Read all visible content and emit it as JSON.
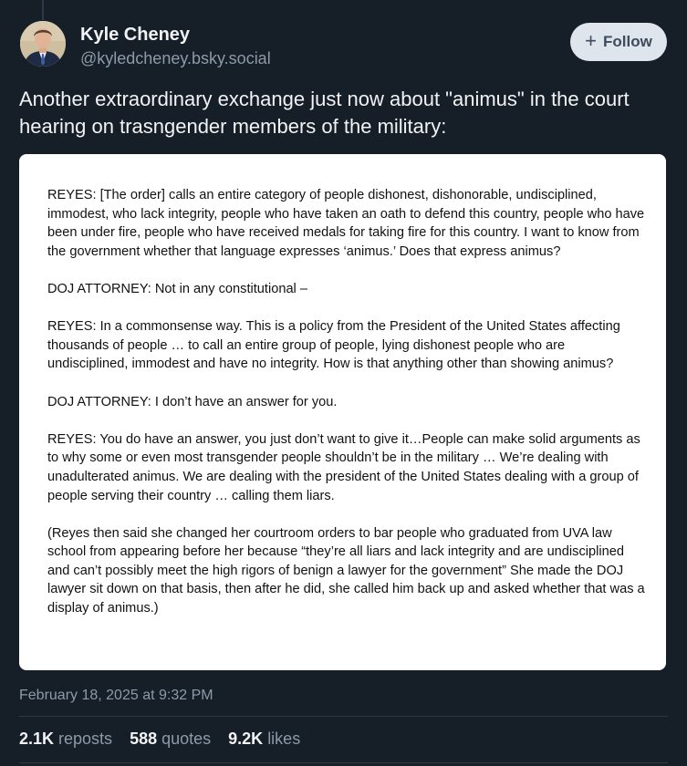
{
  "author": {
    "name": "Kyle Cheney",
    "handle": "@kyledcheney.bsky.social"
  },
  "follow_button": {
    "label": "Follow",
    "icon": "plus-icon"
  },
  "post": {
    "text": "Another extraordinary exchange just now about \"animus\" in the court hearing on trasngender members of the military:",
    "image_paragraphs": [
      "REYES: [The order] calls an entire category of people dishonest, dishonorable, undisciplined, immodest, who lack integrity, people who have taken an oath to defend this country, people who have been under fire, people who have received medals for taking fire for this country. I want to know from the government whether that language expresses ‘animus.’ Does that express animus?",
      "DOJ ATTORNEY: Not in any constitutional –",
      "REYES: In a commonsense way. This is a policy from the President of the United States affecting thousands of people … to call an entire group of people, lying dishonest people who are undisciplined, immodest and have no integrity. How is that anything other than showing animus?",
      "DOJ ATTORNEY: I don’t have an answer for you.",
      "REYES: You do have an answer, you just don’t want to give it…People can make solid arguments as to why some or even most transgender people shouldn’t be in the military … We’re dealing with unadulterated animus. We are dealing with the president of the United States dealing with a group of people serving their country … calling them liars.",
      "(Reyes then said she changed her courtroom orders to bar people who graduated from UVA law school from appearing before her because “they’re all liars and lack integrity and are undisciplined and can’t possibly meet the high rigors of benign a lawyer for the government” She made the DOJ lawyer sit down on that basis, then after he did, she called him back up and asked whether that was a display of  animus.)"
    ],
    "timestamp": "February 18, 2025 at 9:32 PM"
  },
  "stats": [
    {
      "count": "2.1K",
      "label": "reposts"
    },
    {
      "count": "588",
      "label": "quotes"
    },
    {
      "count": "9.2K",
      "label": "likes"
    }
  ],
  "colors": {
    "background": "#161e27",
    "text_primary": "#f1f3f5",
    "text_secondary": "#8d9aa9",
    "follow_bg": "#dfe5ec",
    "follow_text": "#3d4b5c"
  }
}
